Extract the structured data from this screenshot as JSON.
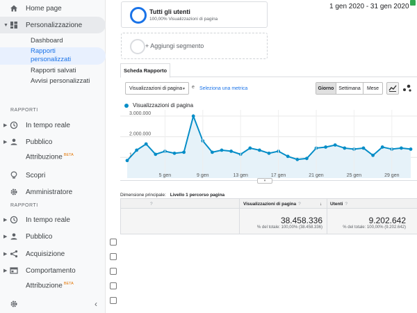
{
  "sidebar": {
    "home": "Home page",
    "custom": "Personalizzazione",
    "sub": [
      "Dashboard",
      "Rapporti personalizzati",
      "Rapporti salvati",
      "Avvisi personalizzati"
    ],
    "section1": "RAPPORTI",
    "realtime": "In tempo reale",
    "audience": "Pubblico",
    "attribution": "Attribuzione",
    "beta": "BETA",
    "discover": "Scopri",
    "admin": "Amministratore",
    "section2": "RAPPORTI",
    "realtime2": "In tempo reale",
    "audience2": "Pubblico",
    "acquisition": "Acquisizione",
    "behavior": "Comportamento",
    "attribution2": "Attribuzione",
    "beta2": "BETA"
  },
  "segment": {
    "title": "Tutti gli utenti",
    "subtitle": "100,00% Visualizzazioni di pagina",
    "add": "+ Aggiungi segmento"
  },
  "date_range": "1 gen 2020 - 31 gen 2020",
  "report": {
    "tab": "Scheda Rapporto",
    "metric_select": "Visualizzazioni di pagina",
    "vs": "e",
    "select_metric": "Seleziona una metrica",
    "ranges": [
      "Giorno",
      "Settimana",
      "Mese"
    ],
    "active_range": "Giorno"
  },
  "chart_data": {
    "type": "area",
    "series": [
      {
        "name": "Visualizzazioni di pagina",
        "color": "#058dc7",
        "x": [
          "1 gen",
          "2 gen",
          "3 gen",
          "4 gen",
          "5 gen",
          "6 gen",
          "7 gen",
          "8 gen",
          "9 gen",
          "10 gen",
          "11 gen",
          "12 gen",
          "13 gen",
          "14 gen",
          "15 gen",
          "16 gen",
          "17 gen",
          "18 gen",
          "19 gen",
          "20 gen",
          "21 gen",
          "22 gen",
          "23 gen",
          "24 gen",
          "25 gen",
          "26 gen",
          "27 gen",
          "28 gen",
          "29 gen",
          "30 gen",
          "31 gen"
        ],
        "values": [
          850000,
          1350000,
          1650000,
          1150000,
          1300000,
          1200000,
          1250000,
          3000000,
          1800000,
          1250000,
          1350000,
          1300000,
          1150000,
          1450000,
          1350000,
          1200000,
          1300000,
          1050000,
          900000,
          950000,
          1450000,
          1500000,
          1600000,
          1450000,
          1400000,
          1450000,
          1100000,
          1500000,
          1400000,
          1450000,
          1400000
        ]
      }
    ],
    "y_ticks": [
      "1.000.000",
      "2.000.000",
      "3.000.000"
    ],
    "x_ticks": [
      "5 gen",
      "9 gen",
      "13 gen",
      "17 gen",
      "21 gen",
      "25 gen",
      "29 gen"
    ],
    "ylim": [
      0,
      3300000
    ]
  },
  "table": {
    "dimension_label": "Dimensione principale:",
    "dimension_value": "Livello 1 percorso pagina",
    "col1": "Visualizzazioni di pagina",
    "col2": "Utenti",
    "total1": "38.458.336",
    "pct1": "% del totale: 100,00% (38.458.336)",
    "total2": "9.202.642",
    "pct2": "% del totale: 100,00% (9.202.642)"
  }
}
